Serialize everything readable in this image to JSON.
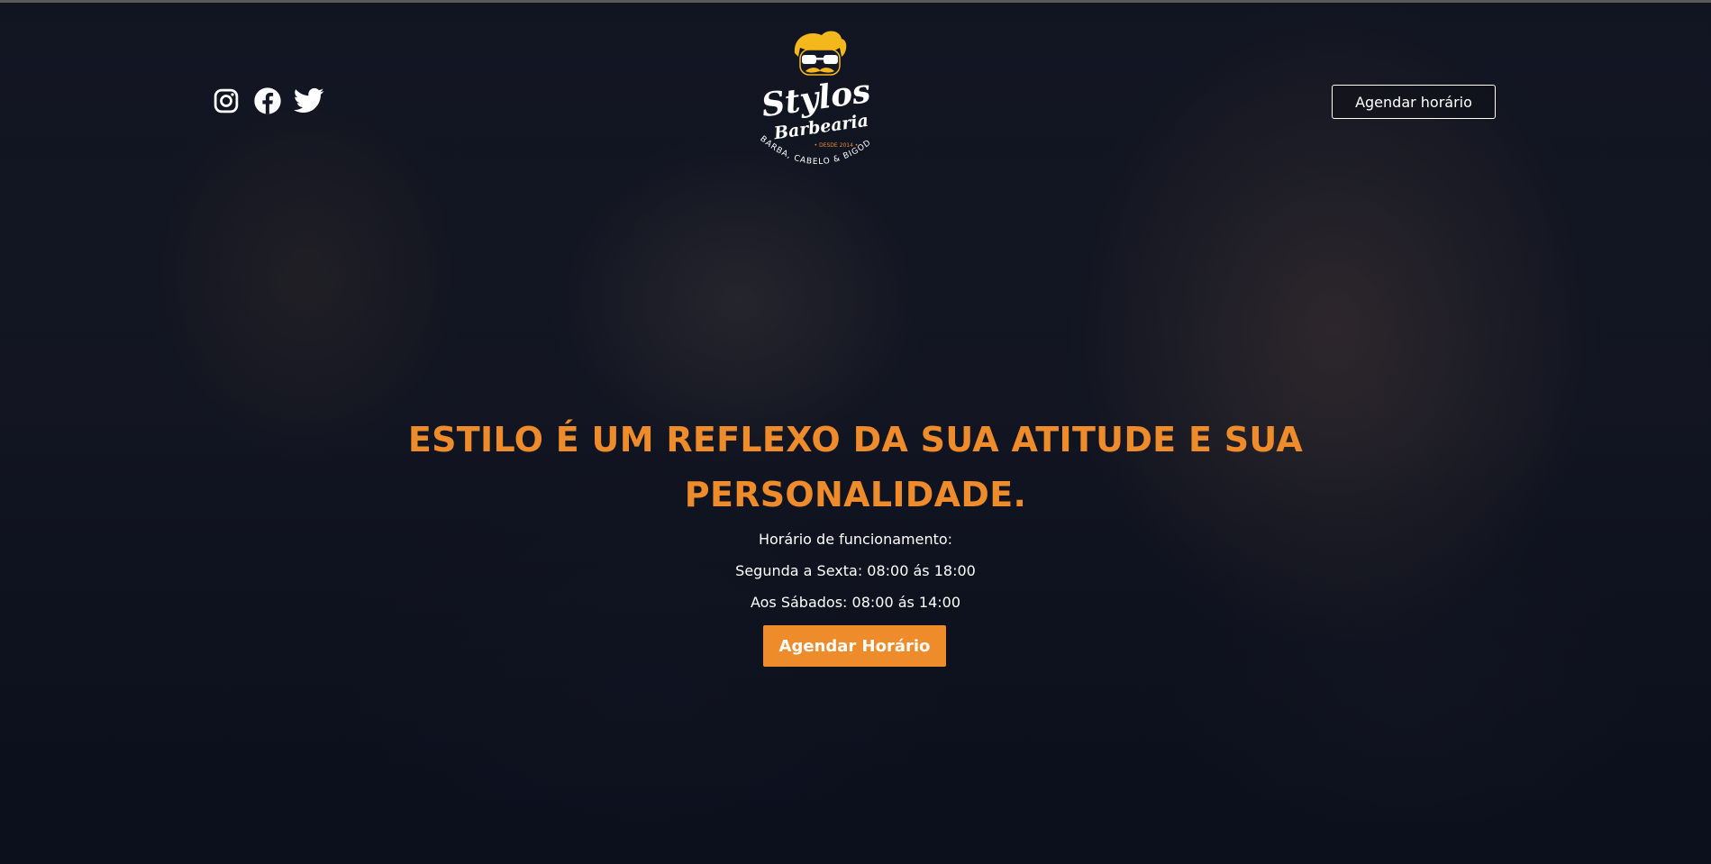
{
  "header": {
    "social": [
      {
        "icon": "instagram-icon",
        "label": "Instagram"
      },
      {
        "icon": "facebook-icon",
        "label": "Facebook"
      },
      {
        "icon": "twitter-icon",
        "label": "Twitter"
      }
    ],
    "logo": {
      "brand": "Stylos",
      "subbrand": "Barbearia",
      "since": "• DESDE 2014 •",
      "tagline": "BARBA, CABELO & BIGODE"
    },
    "cta_label": "Agendar horário"
  },
  "hero": {
    "headline": "ESTILO É UM REFLEXO DA SUA ATITUDE E SUA PERSONALIDADE.",
    "hours_title": "Horário de funcionamento:",
    "hours_weekdays": "Segunda a Sexta: 08:00 ás 18:00",
    "hours_saturday": "Aos Sábados: 08:00 ás 14:00",
    "cta_label": "Agendar Horário"
  },
  "colors": {
    "accent": "#ee8b2a",
    "background": "#0f1420",
    "text": "#ffffff",
    "logo_yellow": "#f5b81c"
  }
}
